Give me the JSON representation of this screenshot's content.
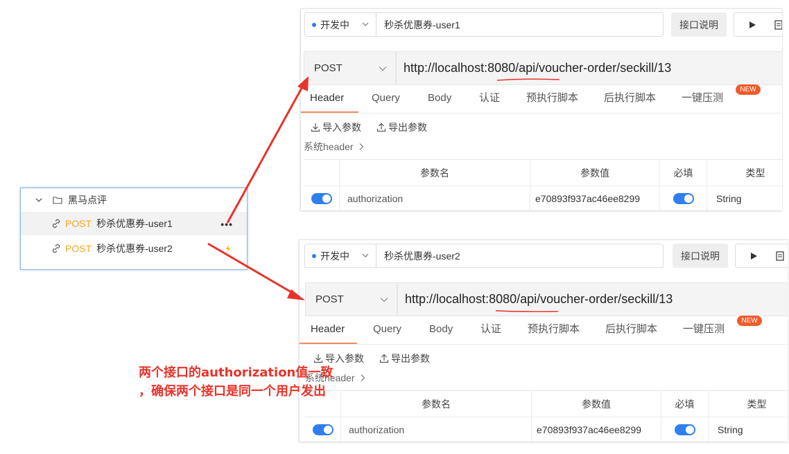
{
  "tree": {
    "folder_name": "黑马点评",
    "items": [
      {
        "method": "POST",
        "name": "秒杀优惠券-user1",
        "trailing": "•••"
      },
      {
        "method": "POST",
        "name": "秒杀优惠券-user2"
      }
    ]
  },
  "panels": [
    {
      "env": "开发中",
      "request_name": "秒杀优惠券-user1",
      "doc_button": "接口说明",
      "method": "POST",
      "url": "http://localhost:8080/api/voucher-order/seckill/13",
      "tabs": [
        "Header",
        "Query",
        "Body",
        "认证",
        "预执行脚本",
        "后执行脚本",
        "一键压测"
      ],
      "new_badge": "NEW",
      "import_label": "导入参数",
      "export_label": "导出参数",
      "system_header": "系统header",
      "columns": [
        "参数名",
        "参数值",
        "必填",
        "类型"
      ],
      "row": {
        "name": "authorization",
        "value": "e70893f937ac46ee8299",
        "type": "String"
      }
    },
    {
      "env": "开发中",
      "request_name": "秒杀优惠券-user2",
      "doc_button": "接口说明",
      "method": "POST",
      "url": "http://localhost:8080/api/voucher-order/seckill/13",
      "tabs": [
        "Header",
        "Query",
        "Body",
        "认证",
        "预执行脚本",
        "后执行脚本",
        "一键压测"
      ],
      "new_badge": "NEW",
      "import_label": "导入参数",
      "export_label": "导出参数",
      "system_header": "系统header",
      "columns": [
        "参数名",
        "参数值",
        "必填",
        "类型"
      ],
      "row": {
        "name": "authorization",
        "value": "e70893f937ac46ee8299",
        "type": "String"
      }
    }
  ],
  "annotation": {
    "line1": "两个接口的authorization值一致",
    "line2": "，确保两个接口是同一个用户发出"
  },
  "colors": {
    "accent": "#2f7ff0",
    "post": "#f5a623",
    "annotation": "#e8332a",
    "tab_active": "#f08a5d",
    "badge": "#f15b2a"
  }
}
